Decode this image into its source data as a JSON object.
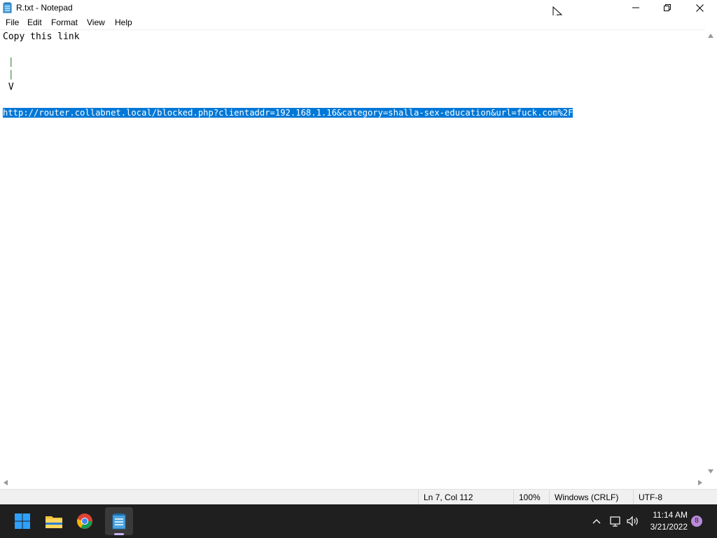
{
  "window": {
    "title": "R.txt - Notepad"
  },
  "menu": {
    "file": "File",
    "edit": "Edit",
    "format": "Format",
    "view": "View",
    "help": "Help"
  },
  "editor": {
    "lines": [
      "Copy this link",
      "",
      " |",
      " |",
      " V",
      "",
      "http://router.collabnet.local/blocked.php?clientaddr=192.168.1.16&category=shalla-sex-education&url=fuck.com%2F"
    ],
    "selected_line": 7,
    "selection_color": "#0078d7"
  },
  "status": {
    "position": "Ln 7, Col 112",
    "zoom": "100%",
    "line_ending": "Windows (CRLF)",
    "encoding": "UTF-8"
  },
  "taskbar": {
    "apps": [
      "start-icon",
      "file-explorer-icon",
      "chrome-icon",
      "notepad-icon"
    ],
    "active_app": "notepad-icon",
    "time": "11:14 AM",
    "date": "3/21/2022",
    "notification_count": "8"
  }
}
